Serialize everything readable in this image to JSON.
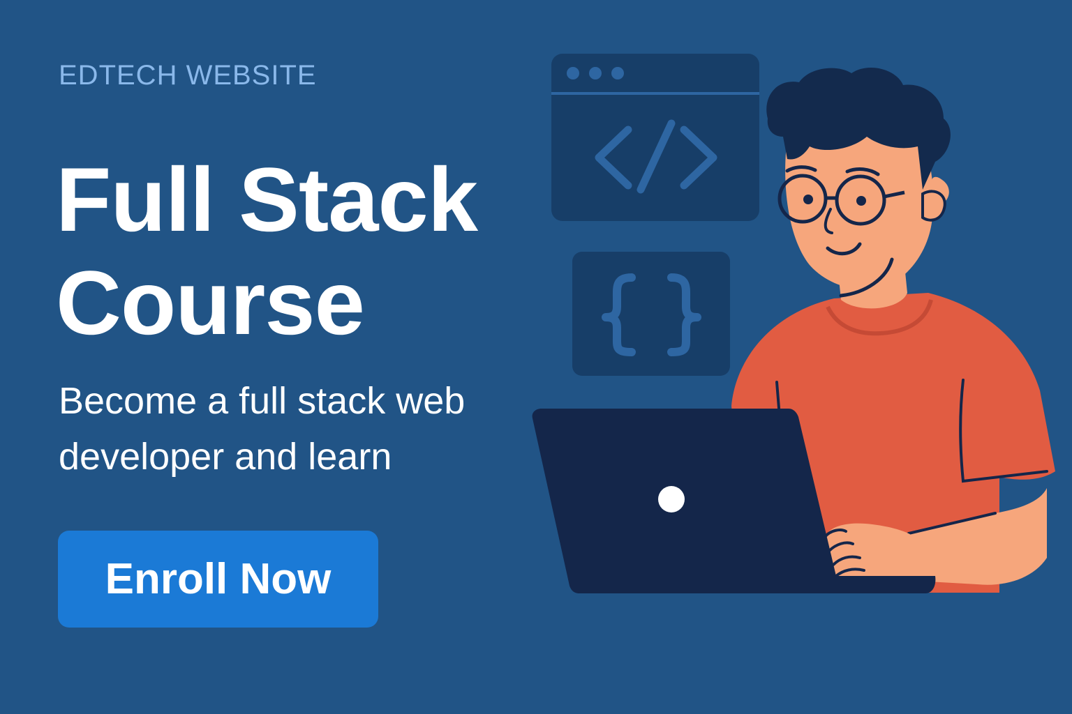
{
  "banner": {
    "eyebrow": "EDTECH WEBSITE",
    "title_line1": "Full Stack",
    "title_line2": "Course",
    "subtitle_line1": "Become a full stack web",
    "subtitle_line2": "developer and learn",
    "cta_label": "Enroll Now"
  },
  "illustration": {
    "code_window_icon": "code-tag-icon",
    "braces_card_icon": "curly-braces-icon",
    "character": "developer-with-laptop"
  },
  "colors": {
    "background": "#215486",
    "eyebrow": "#8ab8ea",
    "headline": "#ffffff",
    "button": "#1b7ad6",
    "card": "#173e68",
    "card_glyph": "#2e66a2",
    "shirt": "#e15c42",
    "skin": "#f6a67c",
    "hair": "#132a4d",
    "laptop": "#14264a"
  }
}
